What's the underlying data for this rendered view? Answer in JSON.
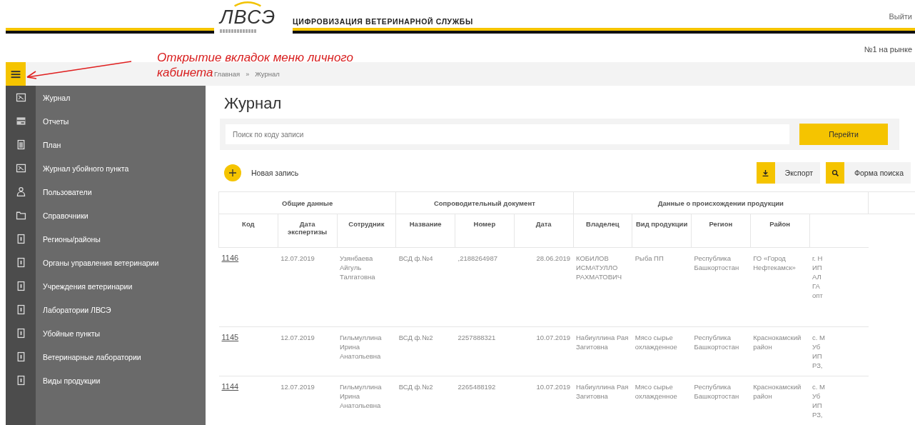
{
  "header": {
    "logo": "ЛВСЭ",
    "title": "ЦИФРОВИЗАЦИЯ ВЕТЕРИНАРНОЙ СЛУЖБЫ",
    "logout": "Выйти",
    "slogan": "№1 на рынке"
  },
  "annotation": {
    "lines": [
      "Открытие вкладок меню личного",
      "кабинета"
    ]
  },
  "breadcrumbs": [
    {
      "label": "Главная",
      "kind": "link"
    },
    {
      "label": "»",
      "kind": "separator"
    },
    {
      "label": "Журнал",
      "kind": "current"
    }
  ],
  "sidebar": {
    "items": [
      {
        "label": "Журнал",
        "kind": "journal"
      },
      {
        "label": "Отчеты",
        "kind": "reports"
      },
      {
        "label": "План",
        "kind": "plan"
      },
      {
        "label": "Журнал убойного пункта",
        "kind": "journal"
      },
      {
        "label": "Пользователи",
        "kind": "users"
      },
      {
        "label": "Справочники",
        "kind": "folder"
      },
      {
        "label": "Регионы/районы",
        "kind": "book"
      },
      {
        "label": "Органы управления ветеринарии",
        "kind": "book"
      },
      {
        "label": "Учреждения ветеринарии",
        "kind": "book"
      },
      {
        "label": "Лаборатории ЛВСЭ",
        "kind": "book"
      },
      {
        "label": "Убойные пункты",
        "kind": "book"
      },
      {
        "label": "Ветеринарные лаборатории",
        "kind": "book"
      },
      {
        "label": "Виды продукции",
        "kind": "book"
      }
    ]
  },
  "page_title": "Журнал",
  "search": {
    "placeholder": "Поиск по коду записи",
    "button": "Перейти"
  },
  "actions": {
    "new_record": "Новая запись",
    "export": "Экспорт",
    "search_form": "Форма поиска"
  },
  "table": {
    "groups": [
      {
        "label": "Общие данные"
      },
      {
        "label": "Сопроводительный документ"
      },
      {
        "label": "Данные о происхождении продукции"
      }
    ],
    "columns": [
      "Код",
      "Дата экспертизы",
      "Сотрудник",
      "Название",
      "Номер",
      "Дата",
      "Владелец",
      "Вид продукции",
      "Регион",
      "Район",
      ""
    ],
    "rows": [
      {
        "cells": [
          "1146",
          "12.07.2019",
          "Узянбаева Айгуль Талгатовна",
          "ВСД ф.№4",
          ",2188264987",
          "28.06.2019",
          "КОБИЛОВ ИСМАТУЛЛО РАХМАТОВИЧ",
          "Рыба ПП",
          "Республика Башкортостан",
          "ГО «Город Нефтекамск»",
          "г. Н\nИП\nАЛ\nГА\nопт"
        ]
      },
      {
        "cells": [
          "1145",
          "12.07.2019",
          "Гильмуллина Ирина Анатольевна",
          "ВСД ф.№2",
          "2257888321",
          "10.07.2019",
          "Набиуллина Рая Загитовна",
          "Мясо сырье охлажденное",
          "Республика Башкортостан",
          "Краснокамский район",
          "с. М\nУб\nИП\nРЗ,"
        ]
      },
      {
        "cells": [
          "1144",
          "12.07.2019",
          "Гильмуллина Ирина Анатольевна",
          "ВСД ф.№2",
          "2265488192",
          "10.07.2019",
          "Набиуллина Рая Загитовна",
          "Мясо сырье охлажденное",
          "Республика Башкортостан",
          "Краснокамский район",
          "с. М\nУб\nИП\nРЗ,"
        ]
      }
    ]
  }
}
